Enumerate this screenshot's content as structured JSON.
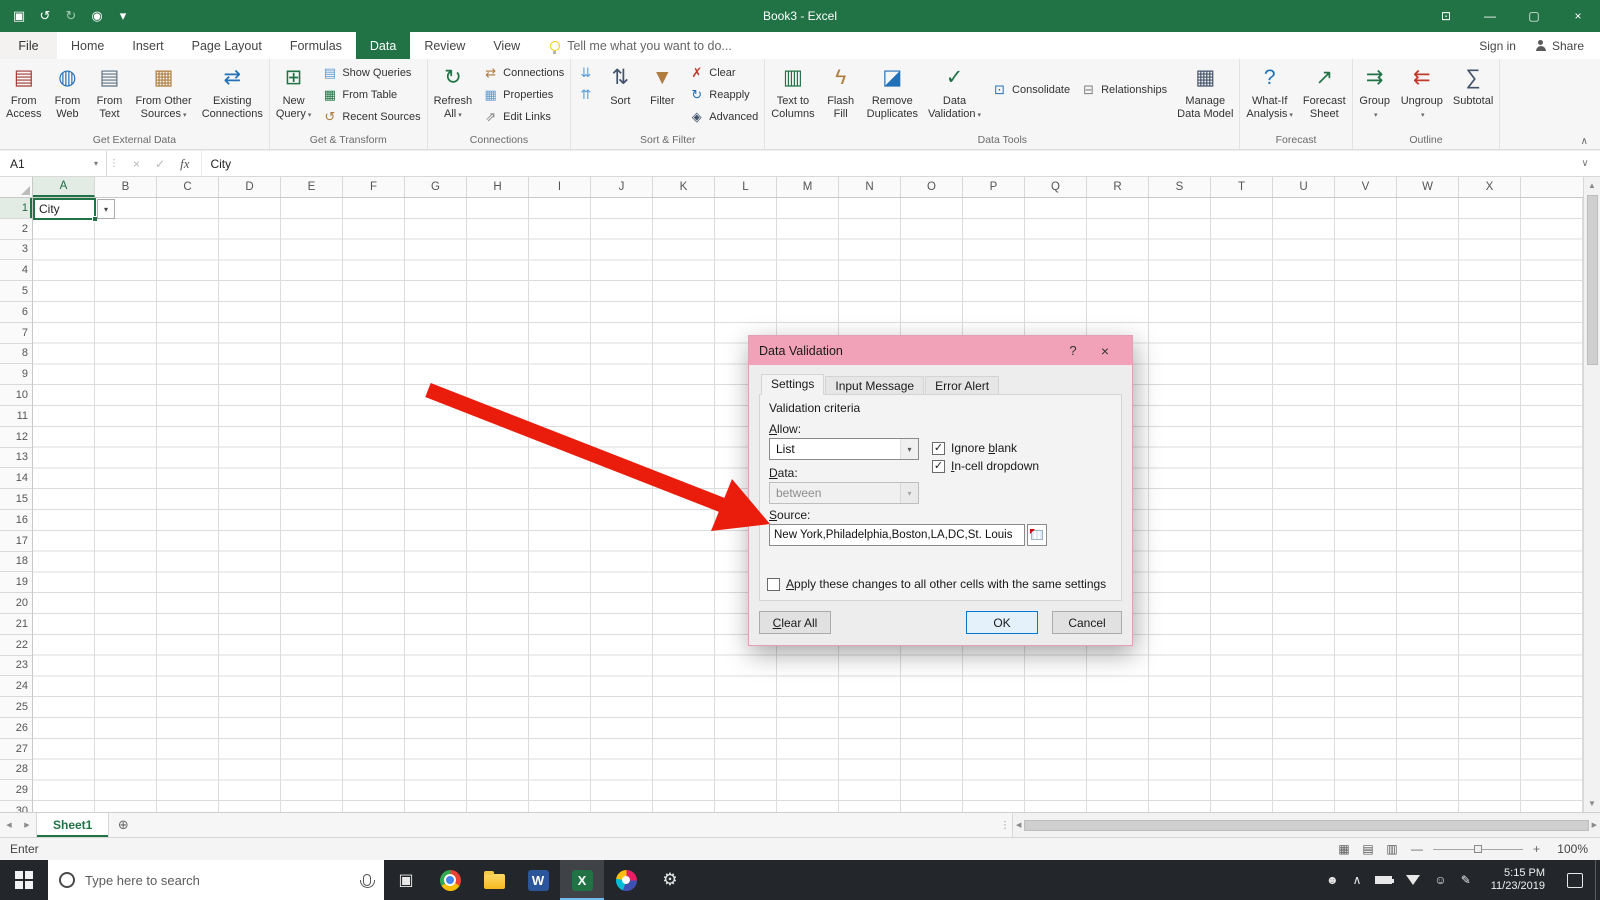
{
  "window": {
    "title": "Book3 - Excel",
    "qat_icons": [
      "save-icon",
      "undo-icon",
      "redo-icon",
      "touch-mode-icon",
      "qat-caret-icon"
    ],
    "control_icons": [
      "ribbon-display-icon",
      "minimize-icon",
      "restore-icon",
      "close-window-icon"
    ]
  },
  "ribbon": {
    "file_tab": "File",
    "tabs": [
      "Home",
      "Insert",
      "Page Layout",
      "Formulas",
      "Data",
      "Review",
      "View"
    ],
    "active_tab": "Data",
    "tell_me": "Tell me what you want to do...",
    "sign_in": "Sign in",
    "share": "Share",
    "groups": [
      {
        "label": "Get External Data",
        "items": [
          {
            "kind": "big",
            "name": "from-access-button",
            "icon": "access-icon",
            "lines": [
              "From",
              "Access"
            ]
          },
          {
            "kind": "big",
            "name": "from-web-button",
            "icon": "web-icon",
            "lines": [
              "From",
              "Web"
            ]
          },
          {
            "kind": "big",
            "name": "from-text-button",
            "icon": "text-file-icon",
            "lines": [
              "From",
              "Text"
            ]
          },
          {
            "kind": "big",
            "name": "from-other-sources-button",
            "icon": "other-sources-icon",
            "lines": [
              "From Other",
              "Sources"
            ],
            "caret": true
          },
          {
            "kind": "big",
            "name": "existing-connections-button",
            "icon": "existing-connections-icon",
            "lines": [
              "Existing",
              "Connections"
            ]
          }
        ]
      },
      {
        "label": "Get & Transform",
        "items": [
          {
            "kind": "big",
            "name": "new-query-button",
            "icon": "new-query-icon",
            "lines": [
              "New",
              "Query"
            ],
            "caret": true
          },
          {
            "kind": "stack",
            "buttons": [
              {
                "name": "show-queries-button",
                "icon": "show-queries-icon",
                "label": "Show Queries"
              },
              {
                "name": "from-table-button",
                "icon": "from-table-icon",
                "label": "From Table"
              },
              {
                "name": "recent-sources-button",
                "icon": "recent-sources-icon",
                "label": "Recent Sources"
              }
            ]
          }
        ]
      },
      {
        "label": "Connections",
        "items": [
          {
            "kind": "big",
            "name": "refresh-all-button",
            "icon": "refresh-icon",
            "lines": [
              "Refresh",
              "All"
            ],
            "caret": true
          },
          {
            "kind": "stack",
            "buttons": [
              {
                "name": "connections-button",
                "icon": "connections-icon",
                "label": "Connections"
              },
              {
                "name": "properties-button",
                "icon": "properties-icon",
                "label": "Properties"
              },
              {
                "name": "edit-links-button",
                "icon": "edit-links-icon",
                "label": "Edit Links"
              }
            ]
          }
        ]
      },
      {
        "label": "Sort & Filter",
        "items": [
          {
            "kind": "stack",
            "buttons": [
              {
                "name": "sort-ascending-button",
                "icon": "sort-az-icon",
                "label": ""
              },
              {
                "name": "sort-descending-button",
                "icon": "sort-za-icon",
                "label": ""
              }
            ]
          },
          {
            "kind": "big",
            "name": "sort-button",
            "icon": "sort-icon",
            "lines": [
              "Sort"
            ]
          },
          {
            "kind": "big",
            "name": "filter-button",
            "icon": "filter-icon",
            "lines": [
              "Filter"
            ]
          },
          {
            "kind": "stack",
            "buttons": [
              {
                "name": "clear-filter-button",
                "icon": "clear-icon",
                "label": "Clear"
              },
              {
                "name": "reapply-button",
                "icon": "reapply-icon",
                "label": "Reapply"
              },
              {
                "name": "advanced-button",
                "icon": "advanced-icon",
                "label": "Advanced"
              }
            ]
          }
        ]
      },
      {
        "label": "Data Tools",
        "items": [
          {
            "kind": "big",
            "name": "text-to-columns-button",
            "icon": "text-to-columns-icon",
            "lines": [
              "Text to",
              "Columns"
            ]
          },
          {
            "kind": "big",
            "name": "flash-fill-button",
            "icon": "flash-fill-icon",
            "lines": [
              "Flash",
              "Fill"
            ]
          },
          {
            "kind": "big",
            "name": "remove-duplicates-button",
            "icon": "remove-duplicates-icon",
            "lines": [
              "Remove",
              "Duplicates"
            ]
          },
          {
            "kind": "big",
            "name": "data-validation-button",
            "icon": "data-validation-icon",
            "lines": [
              "Data",
              "Validation"
            ],
            "caret": true
          },
          {
            "kind": "stack",
            "mid": true,
            "buttons": [
              {
                "name": "consolidate-button",
                "icon": "consolidate-icon",
                "label": "Consolidate"
              }
            ]
          },
          {
            "kind": "stack",
            "mid": true,
            "buttons": [
              {
                "name": "relationships-button",
                "icon": "relationships-icon",
                "label": "Relationships"
              }
            ]
          },
          {
            "kind": "big",
            "name": "manage-data-model-button",
            "icon": "data-model-icon",
            "lines": [
              "Manage",
              "Data Model"
            ]
          }
        ]
      },
      {
        "label": "Forecast",
        "items": [
          {
            "kind": "big",
            "name": "what-if-analysis-button",
            "icon": "what-if-icon",
            "lines": [
              "What-If",
              "Analysis"
            ],
            "caret": true
          },
          {
            "kind": "big",
            "name": "forecast-sheet-button",
            "icon": "forecast-sheet-icon",
            "lines": [
              "Forecast",
              "Sheet"
            ]
          }
        ]
      },
      {
        "label": "Outline",
        "items": [
          {
            "kind": "big",
            "name": "group-button",
            "icon": "group-icon",
            "lines": [
              "Group"
            ],
            "caret": true
          },
          {
            "kind": "big",
            "name": "ungroup-button",
            "icon": "ungroup-icon",
            "lines": [
              "Ungroup"
            ],
            "caret": true
          },
          {
            "kind": "big",
            "name": "subtotal-button",
            "icon": "subtotal-icon",
            "lines": [
              "Subtotal"
            ]
          }
        ]
      }
    ]
  },
  "formula_bar": {
    "name_box": "A1",
    "content": "City"
  },
  "grid": {
    "columns": [
      "A",
      "B",
      "C",
      "D",
      "E",
      "F",
      "G",
      "H",
      "I",
      "J",
      "K",
      "L",
      "M",
      "N",
      "O",
      "P",
      "Q",
      "R",
      "S",
      "T",
      "U",
      "V",
      "W",
      "X"
    ],
    "row_count": 30,
    "selected_column": "A",
    "selected_row": 1,
    "selected_cell": "A1",
    "cells": {
      "A1": "City"
    }
  },
  "sheet_tabs": {
    "tabs": [
      "Sheet1"
    ],
    "active": "Sheet1"
  },
  "status_bar": {
    "mode": "Enter",
    "zoom": "100%",
    "views": [
      "normal",
      "page-layout",
      "page-break"
    ]
  },
  "dialog": {
    "title": "Data Validation",
    "help_label": "?",
    "tabs": [
      "Settings",
      "Input Message",
      "Error Alert"
    ],
    "active_tab": "Settings",
    "validation_criteria": "Validation criteria",
    "allow_label_html": "<u>A</u>llow:",
    "allow_value": "List",
    "ignore_blank_html": "Ignore <u>b</u>lank",
    "in_cell_html": "<u>I</u>n-cell dropdown",
    "data_label_html": "<u>D</u>ata:",
    "data_value": "between",
    "source_label_html": "<u>S</u>ource:",
    "source_value": "New York,Philadelphia,Boston,LA,DC,St. Louis",
    "apply_label_html": "<u>A</u>pply these changes to all other cells with the same settings",
    "clear_all_html": "<u>C</u>lear All",
    "ok": "OK",
    "cancel": "Cancel"
  },
  "taskbar": {
    "search_placeholder": "Type here to search",
    "apps": [
      {
        "name": "task-view"
      },
      {
        "name": "chrome"
      },
      {
        "name": "file-explorer"
      },
      {
        "name": "word"
      },
      {
        "name": "excel",
        "active": true
      },
      {
        "name": "paint-3d"
      },
      {
        "name": "settings"
      }
    ],
    "tray": [
      "people",
      "hidden-icons",
      "battery",
      "wifi",
      "smiley",
      "pen"
    ],
    "clock": {
      "time": "5:15 PM",
      "date": "11/23/2019"
    }
  },
  "annotation": {
    "arrow_color": "#ea1c0c"
  }
}
